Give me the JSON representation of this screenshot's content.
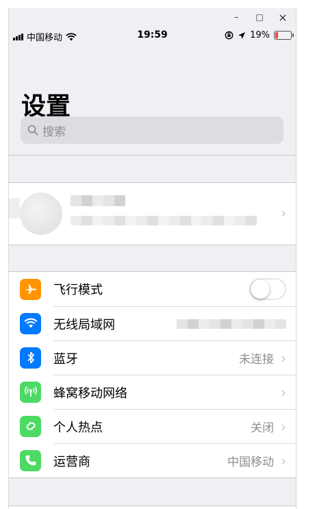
{
  "window": {
    "controls": {
      "minimize": "–",
      "maximize": "□",
      "close": "×"
    }
  },
  "status_bar": {
    "carrier": "中国移动",
    "time": "19:59",
    "battery_percent": "19%",
    "battery_level": 0.19,
    "battery_color": "#ff3b30"
  },
  "page": {
    "title": "设置",
    "search_placeholder": "搜索"
  },
  "settings": [
    {
      "label": "飞行模式",
      "icon": "airplane-icon",
      "icon_color": "#ff9500",
      "type": "toggle",
      "toggle_on": false
    },
    {
      "label": "无线局域网",
      "icon": "wifi-icon",
      "icon_color": "#007aff",
      "type": "blurred-value"
    },
    {
      "label": "蓝牙",
      "icon": "bluetooth-icon",
      "icon_color": "#007aff",
      "type": "value",
      "value": "未连接"
    },
    {
      "label": "蜂窝移动网络",
      "icon": "cellular-icon",
      "icon_color": "#4cd964",
      "type": "chevron"
    },
    {
      "label": "个人热点",
      "icon": "hotspot-icon",
      "icon_color": "#4cd964",
      "type": "value",
      "value": "关闭"
    },
    {
      "label": "运营商",
      "icon": "carrier-phone-icon",
      "icon_color": "#4cd964",
      "type": "value",
      "value": "中国移动"
    }
  ]
}
